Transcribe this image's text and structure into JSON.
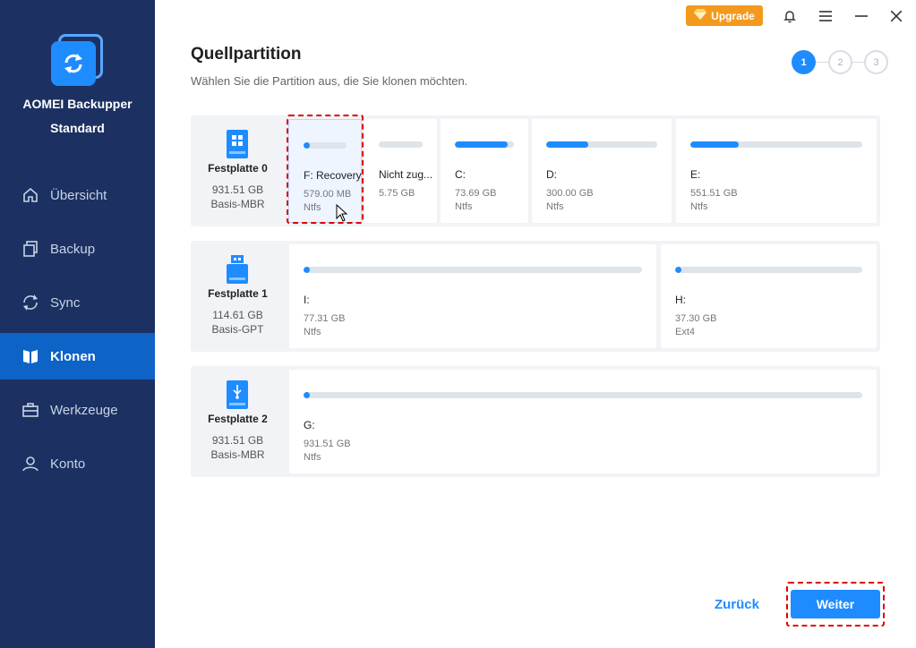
{
  "app": {
    "name": "AOMEI Backupper",
    "edition": "Standard"
  },
  "titlebar": {
    "upgrade_label": "Upgrade"
  },
  "sidebar": {
    "items": [
      {
        "label": "Übersicht",
        "icon": "home-icon",
        "active": false
      },
      {
        "label": "Backup",
        "icon": "backup-icon",
        "active": false
      },
      {
        "label": "Sync",
        "icon": "sync-icon",
        "active": false
      },
      {
        "label": "Klonen",
        "icon": "clone-icon",
        "active": true
      },
      {
        "label": "Werkzeuge",
        "icon": "toolbox-icon",
        "active": false
      },
      {
        "label": "Konto",
        "icon": "user-icon",
        "active": false
      }
    ]
  },
  "header": {
    "title": "Quellpartition",
    "subtitle": "Wählen Sie die Partition aus, die Sie klonen möchten.",
    "steps": [
      "1",
      "2",
      "3"
    ],
    "current_step": 1
  },
  "disks": [
    {
      "name": "Festplatte 0",
      "size": "931.51 GB",
      "type": "Basis-MBR",
      "icon": "windows-disk-icon",
      "partitions": [
        {
          "label": "F: Recovery",
          "size": "579.00 MB",
          "fs": "Ntfs",
          "used": 0.06,
          "selected": true
        },
        {
          "label": "Nicht zug...",
          "size": "5.75 GB",
          "fs": "",
          "used": 0,
          "selected": false
        },
        {
          "label": "C:",
          "size": "73.69 GB",
          "fs": "Ntfs",
          "used": 0.9,
          "selected": false
        },
        {
          "label": "D:",
          "size": "300.00 GB",
          "fs": "Ntfs",
          "used": 0.38,
          "selected": false
        },
        {
          "label": "E:",
          "size": "551.51 GB",
          "fs": "Ntfs",
          "used": 0.28,
          "selected": false
        }
      ]
    },
    {
      "name": "Festplatte 1",
      "size": "114.61 GB",
      "type": "Basis-GPT",
      "icon": "usb-disk-icon",
      "partitions": [
        {
          "label": "I:",
          "size": "77.31 GB",
          "fs": "Ntfs",
          "used": 0.01,
          "selected": false
        },
        {
          "label": "H:",
          "size": "37.30 GB",
          "fs": "Ext4",
          "used": 0.02,
          "selected": false
        }
      ]
    },
    {
      "name": "Festplatte 2",
      "size": "931.51 GB",
      "type": "Basis-MBR",
      "icon": "usb-disk-icon",
      "partitions": [
        {
          "label": "G:",
          "size": "931.51 GB",
          "fs": "Ntfs",
          "used": 0.01,
          "selected": false
        }
      ]
    }
  ],
  "footer": {
    "back_label": "Zurück",
    "next_label": "Weiter"
  },
  "colors": {
    "sidebar": "#1c3162",
    "accent": "#1e8cff",
    "upgrade": "#f39a1e",
    "highlight": "#e00000"
  }
}
